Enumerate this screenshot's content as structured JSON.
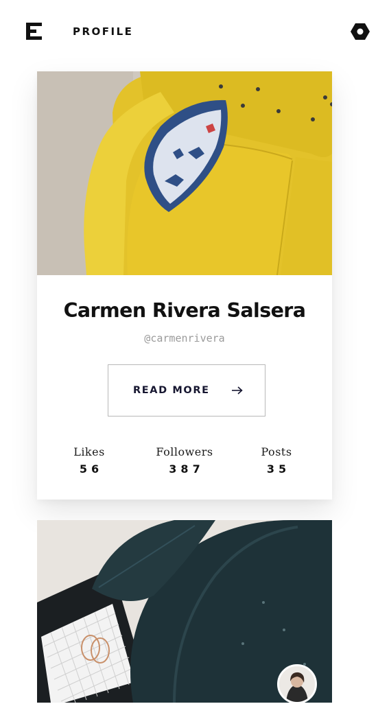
{
  "header": {
    "title": "PROFILE",
    "menu_icon": "hamburger-menu-icon",
    "settings_icon": "hexagon-settings-icon"
  },
  "profile": {
    "name": "Carmen Rivera Salsera",
    "handle": "@carmenrivera",
    "cover_image": "yellow sofa with blue pillow"
  },
  "actions": {
    "read_more_label": "READ MORE",
    "read_more_icon": "arrow-right-icon"
  },
  "stats": [
    {
      "label": "Likes",
      "value": "56"
    },
    {
      "label": "Followers",
      "value": "387"
    },
    {
      "label": "Posts",
      "value": "35"
    }
  ],
  "next_card": {
    "image": "dark green leaf over tray with gold rings",
    "avatar": "user avatar photo"
  },
  "colors": {
    "accent_yellow": "#E6C72A",
    "text_dark": "#111111",
    "handle_gray": "#9A9A9A",
    "button_border": "#B8B8B8",
    "leaf_dark": "#1E3238"
  }
}
